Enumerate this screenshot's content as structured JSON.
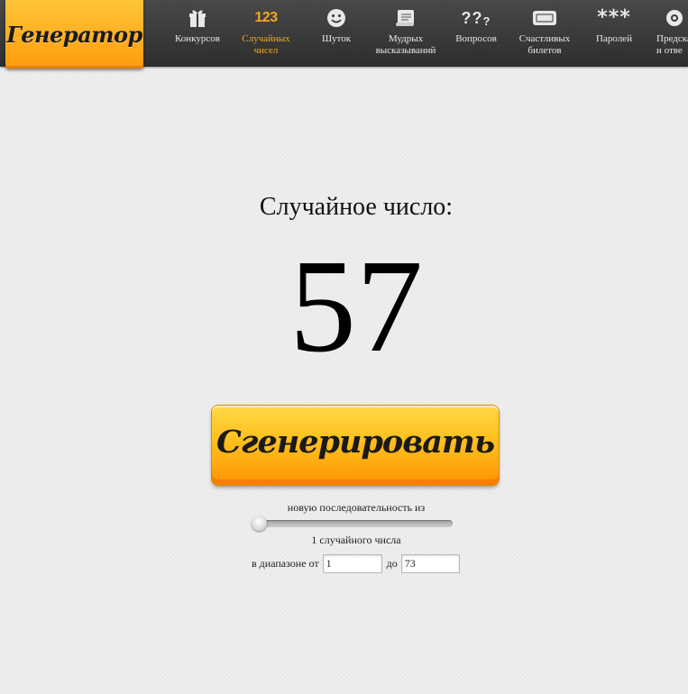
{
  "logo": {
    "text": "Генератор"
  },
  "nav": [
    {
      "label": "Конкурсов",
      "icon": "gift-icon",
      "icon_text": ""
    },
    {
      "label": "Случайных\nчисел",
      "icon": "numbers-icon",
      "icon_text": "123",
      "active": true
    },
    {
      "label": "Шуток",
      "icon": "smiley-icon",
      "icon_text": ""
    },
    {
      "label": "Мудрых\nвысказываний",
      "icon": "scroll-icon",
      "icon_text": ""
    },
    {
      "label": "Вопросов",
      "icon": "question-marks-icon",
      "icon_text": "??"
    },
    {
      "label": "Счастливых\nбилетов",
      "icon": "ticket-icon",
      "icon_text": ""
    },
    {
      "label": "Паролей",
      "icon": "asterisks-icon",
      "icon_text": "***"
    },
    {
      "label": "Предска\nи отве",
      "icon": "magic-ball-icon",
      "icon_text": ""
    }
  ],
  "main": {
    "heading": "Случайное число:",
    "result": "57",
    "generate_label": "Сгенерировать",
    "sequence_caption": "новую последовательность из",
    "count_caption": "1 случайного числа",
    "range_from_label": "в диапазоне от",
    "range_from_value": "1",
    "range_to_label": "до",
    "range_to_value": "73",
    "slider_value": 1
  },
  "colors": {
    "accent": "#f6a623",
    "topbar": "#363636",
    "button": "#ffb414"
  }
}
